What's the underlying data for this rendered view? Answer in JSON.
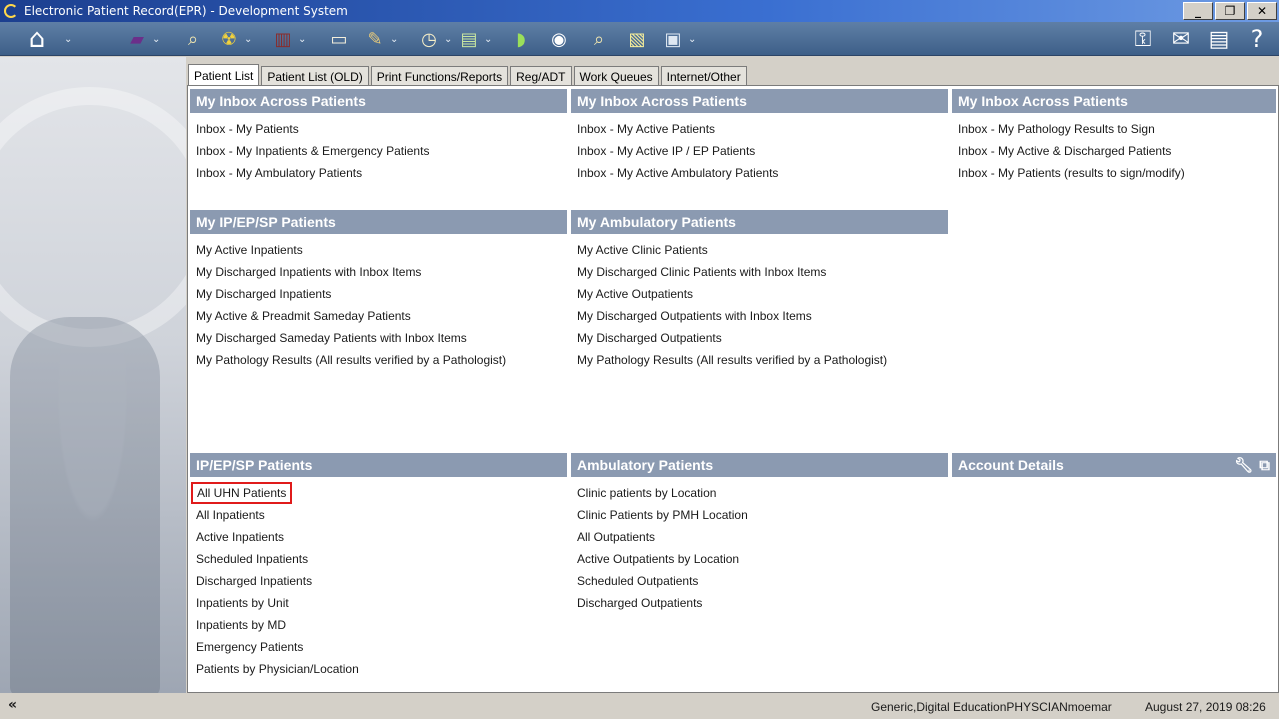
{
  "window": {
    "title": "Electronic Patient Record(EPR) - Development System",
    "minimize": "_",
    "restore": "❐",
    "close": "✕"
  },
  "toolbar": {
    "icons": [
      {
        "name": "home-icon",
        "glyph": "⌂",
        "has_menu": true
      },
      {
        "name": "book-icon",
        "glyph": "▰",
        "has_menu": true
      },
      {
        "name": "patient-search-icon",
        "glyph": "⌕",
        "has_menu": false
      },
      {
        "name": "radiation-icon",
        "glyph": "☢",
        "has_menu": true
      },
      {
        "name": "building-icon",
        "glyph": "▥",
        "has_menu": true
      },
      {
        "name": "bandage-icon",
        "glyph": "▭",
        "has_menu": false
      },
      {
        "name": "notes-icon",
        "glyph": "✎",
        "has_menu": true
      },
      {
        "name": "clock-icon",
        "glyph": "◷",
        "has_menu": true
      },
      {
        "name": "report-icon",
        "glyph": "▤",
        "has_menu": true
      },
      {
        "name": "pill-icon",
        "glyph": "◗",
        "has_menu": false
      },
      {
        "name": "network-icon",
        "glyph": "◉",
        "has_menu": false
      },
      {
        "name": "lookup-icon",
        "glyph": "⌕",
        "has_menu": false
      },
      {
        "name": "document-icon",
        "glyph": "▧",
        "has_menu": false
      },
      {
        "name": "computer-icon",
        "glyph": "▣",
        "has_menu": true
      }
    ],
    "right_icons": [
      {
        "name": "key-icon",
        "glyph": "⚿"
      },
      {
        "name": "mail-icon",
        "glyph": "✉"
      },
      {
        "name": "checklist-icon",
        "glyph": "▤"
      },
      {
        "name": "help-icon",
        "glyph": "?"
      }
    ],
    "caret": "⌄"
  },
  "tabs": [
    "Patient List",
    "Patient List (OLD)",
    "Print Functions/Reports",
    "Reg/ADT",
    "Work Queues",
    "Internet/Other"
  ],
  "sections": {
    "inbox1": {
      "title": "My Inbox Across Patients",
      "links": [
        "Inbox - My Patients",
        "Inbox - My Inpatients &  Emergency Patients",
        "Inbox - My Ambulatory Patients"
      ]
    },
    "inbox2": {
      "title": "My Inbox Across Patients",
      "links": [
        "Inbox - My Active Patients",
        "Inbox - My Active IP / EP Patients",
        "Inbox - My Active Ambulatory Patients"
      ]
    },
    "inbox3": {
      "title": "My Inbox Across Patients",
      "links": [
        "Inbox - My Pathology Results to Sign",
        "Inbox - My Active & Discharged Patients",
        "Inbox - My Patients (results to sign/modify)"
      ]
    },
    "my_ip": {
      "title": "My IP/EP/SP Patients",
      "links": [
        "My Active Inpatients",
        "My Discharged Inpatients with Inbox Items",
        "My Discharged Inpatients",
        "My Active & Preadmit Sameday Patients",
        "My Discharged Sameday Patients with Inbox Items",
        "My Pathology Results (All results verified by a Pathologist)"
      ]
    },
    "my_amb": {
      "title": "My Ambulatory Patients",
      "links": [
        "My Active Clinic Patients",
        "My Discharged Clinic Patients with Inbox Items",
        "My Active Outpatients",
        "My Discharged Outpatients with Inbox Items",
        "My Discharged Outpatients",
        "My Pathology Results (All results verified by a Pathologist)"
      ]
    },
    "ip": {
      "title": "IP/EP/SP Patients",
      "links": [
        "All UHN Patients",
        "All Inpatients",
        "Active Inpatients",
        "Scheduled Inpatients",
        "Discharged Inpatients",
        "Inpatients by Unit",
        "Inpatients by MD",
        "Emergency Patients",
        "Patients by Physician/Location"
      ]
    },
    "amb": {
      "title": "Ambulatory Patients",
      "links": [
        "Clinic patients by Location",
        "Clinic Patients by PMH Location",
        "All Outpatients",
        "Active Outpatients by Location",
        "Scheduled Outpatients",
        "Discharged Outpatients"
      ]
    },
    "account": {
      "title": "Account Details",
      "tools": [
        "wrench-icon",
        "external-link-icon"
      ]
    }
  },
  "status": {
    "collapse": "«",
    "user": "Generic,Digital EducationPHYSCIANmoemar",
    "datetime": "August 27, 2019 08:26"
  }
}
